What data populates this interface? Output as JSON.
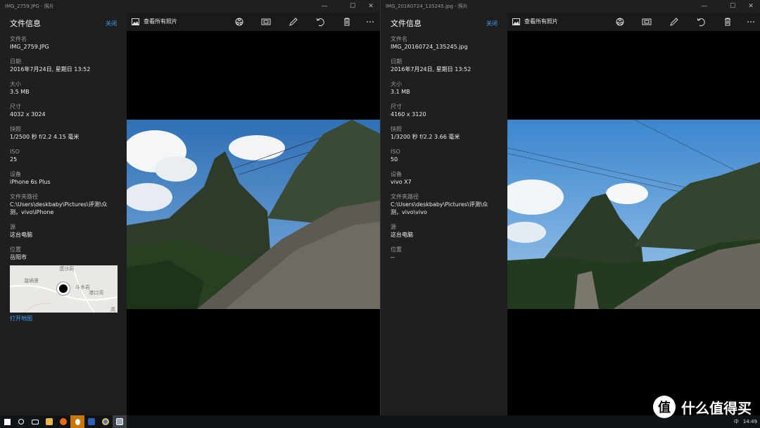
{
  "left": {
    "title": "IMG_2759.JPG - 照片",
    "panel_title": "文件信息",
    "close": "关闭",
    "view_all": "查看所有照片",
    "fields": [
      {
        "label": "文件名",
        "value": "IMG_2759.JPG"
      },
      {
        "label": "日期",
        "value": "2016年7月24日, 星期日 13:52"
      },
      {
        "label": "大小",
        "value": "3.5 MB"
      },
      {
        "label": "尺寸",
        "value": "4032 x 3024"
      },
      {
        "label": "快照",
        "value": "1/2500 秒 f/2.2 4.15 毫米"
      },
      {
        "label": "ISO",
        "value": "25"
      },
      {
        "label": "设备",
        "value": "iPhone 6s Plus"
      },
      {
        "label": "文件夹路径",
        "value": "C:\\Users\\deskbaby\\Pictures\\评测\\众测，vivo\\iPhone"
      },
      {
        "label": "源",
        "value": "这台电脑"
      },
      {
        "label": "位置",
        "value": "岳阳市"
      }
    ],
    "map_labels": [
      "漠沙洞",
      "漩埚里",
      "斗水岩",
      "港口湾",
      "高"
    ],
    "open_map": "打开地图"
  },
  "right": {
    "title": "IMG_20160724_135245.jpg - 照片",
    "panel_title": "文件信息",
    "close": "关闭",
    "view_all": "查看所有照片",
    "fields": [
      {
        "label": "文件名",
        "value": "IMG_20160724_135245.jpg"
      },
      {
        "label": "日期",
        "value": "2016年7月24日, 星期日 13:52"
      },
      {
        "label": "大小",
        "value": "3.1 MB"
      },
      {
        "label": "尺寸",
        "value": "4160 x 3120"
      },
      {
        "label": "快照",
        "value": "1/3200 秒 f/2.2 3.66 毫米"
      },
      {
        "label": "ISO",
        "value": "50"
      },
      {
        "label": "设备",
        "value": "vivo X7"
      },
      {
        "label": "文件夹路径",
        "value": "C:\\Users\\deskbaby\\Pictures\\评测\\众测，vivo\\vivo"
      },
      {
        "label": "源",
        "value": "这台电脑"
      },
      {
        "label": "位置",
        "value": "--"
      }
    ]
  },
  "window_controls": [
    "—",
    "☐",
    "✕"
  ],
  "toolbar_icons": [
    "enhance-icon",
    "slideshow-icon",
    "edit-icon",
    "rotate-icon",
    "delete-icon",
    "more-icon"
  ],
  "taskbar": {
    "icons": [
      "start-icon",
      "search-icon",
      "taskview-icon",
      "explorer-icon",
      "browser-icon",
      "qq-icon",
      "word-icon",
      "chrome-icon",
      "photos-icon"
    ],
    "time": "14:49",
    "ime": "中"
  },
  "watermark": {
    "logo": "值",
    "text": "什么值得买"
  },
  "colors": {
    "accent": "#3ea0ff",
    "panel": "#1f1f1f",
    "sky": "#4a8fd4"
  }
}
